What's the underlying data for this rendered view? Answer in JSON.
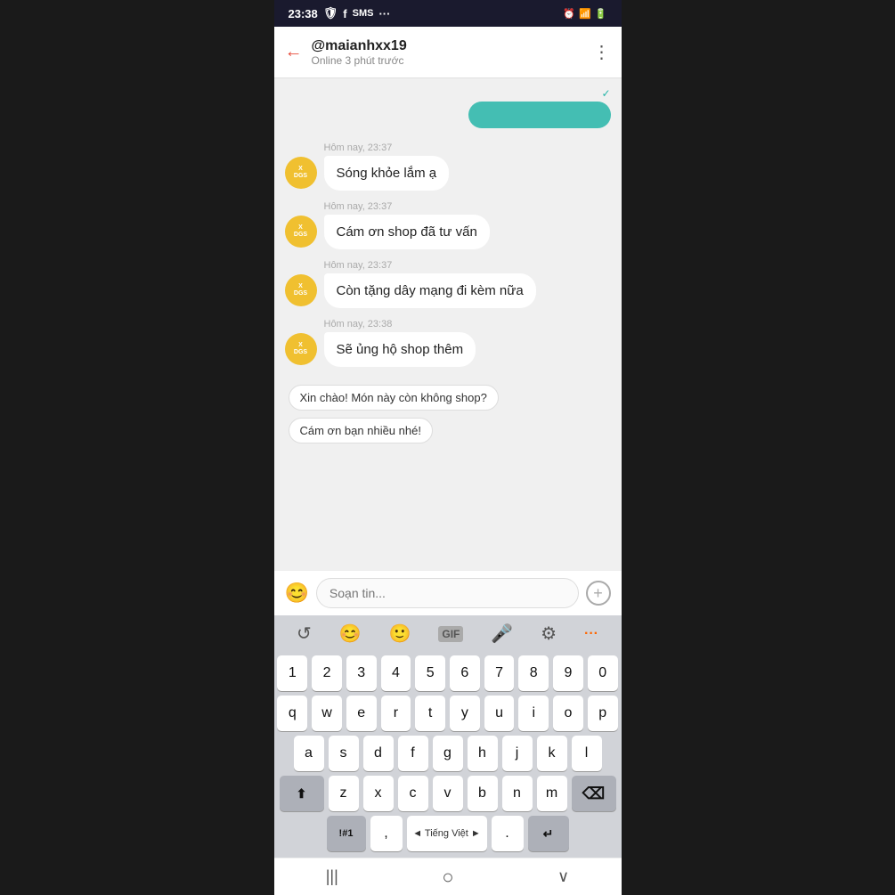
{
  "statusBar": {
    "time": "23:38",
    "icons": [
      "shield",
      "facebook",
      "sms",
      "more"
    ],
    "rightIcons": [
      "alarm",
      "wifi",
      "signal",
      "battery"
    ]
  },
  "header": {
    "backLabel": "←",
    "username": "@maianhxx19",
    "status": "Online 3 phút trước",
    "moreLabel": "⋮"
  },
  "messages": [
    {
      "id": "msg-partial",
      "type": "outgoing",
      "text": "",
      "time": ""
    },
    {
      "id": "msg1",
      "type": "incoming",
      "time": "Hôm nay, 23:37",
      "text": "Sóng khỏe lắm ạ",
      "avatarText": "X DGS"
    },
    {
      "id": "msg2",
      "type": "incoming",
      "time": "Hôm nay, 23:37",
      "text": "Cám ơn shop đã tư vấn",
      "avatarText": "X DGS"
    },
    {
      "id": "msg3",
      "type": "incoming",
      "time": "Hôm nay, 23:37",
      "text": "Còn tặng dây mạng đi kèm nữa",
      "avatarText": "X DGS"
    },
    {
      "id": "msg4",
      "type": "incoming",
      "time": "Hôm nay, 23:38",
      "text": "Sẽ ủng hộ shop thêm",
      "avatarText": "X DGS"
    }
  ],
  "quickReplies": [
    {
      "id": "qr1",
      "text": "Xin chào! Món này còn không shop?"
    },
    {
      "id": "qr2",
      "text": "Cám ơn bạn nhiều nhé!"
    }
  ],
  "inputArea": {
    "placeholder": "Soạn tin...",
    "emojiIcon": "😊",
    "addIcon": "+"
  },
  "keyboardToolbar": {
    "icons": [
      "translate",
      "emoji",
      "sticker",
      "gif",
      "mic",
      "settings",
      "more"
    ]
  },
  "keyboard": {
    "rows": [
      [
        "1",
        "2",
        "3",
        "4",
        "5",
        "6",
        "7",
        "8",
        "9",
        "0"
      ],
      [
        "q",
        "w",
        "e",
        "r",
        "t",
        "y",
        "u",
        "i",
        "o",
        "p"
      ],
      [
        "a",
        "s",
        "d",
        "f",
        "g",
        "h",
        "j",
        "k",
        "l"
      ],
      [
        "⬆",
        "z",
        "x",
        "c",
        "v",
        "b",
        "n",
        "m",
        "⌫"
      ],
      [
        "!#1",
        ",",
        "◄ Tiếng Việt ►",
        ".",
        "↵"
      ]
    ]
  },
  "navBar": {
    "icons": [
      "|||",
      "○",
      "∨"
    ]
  }
}
